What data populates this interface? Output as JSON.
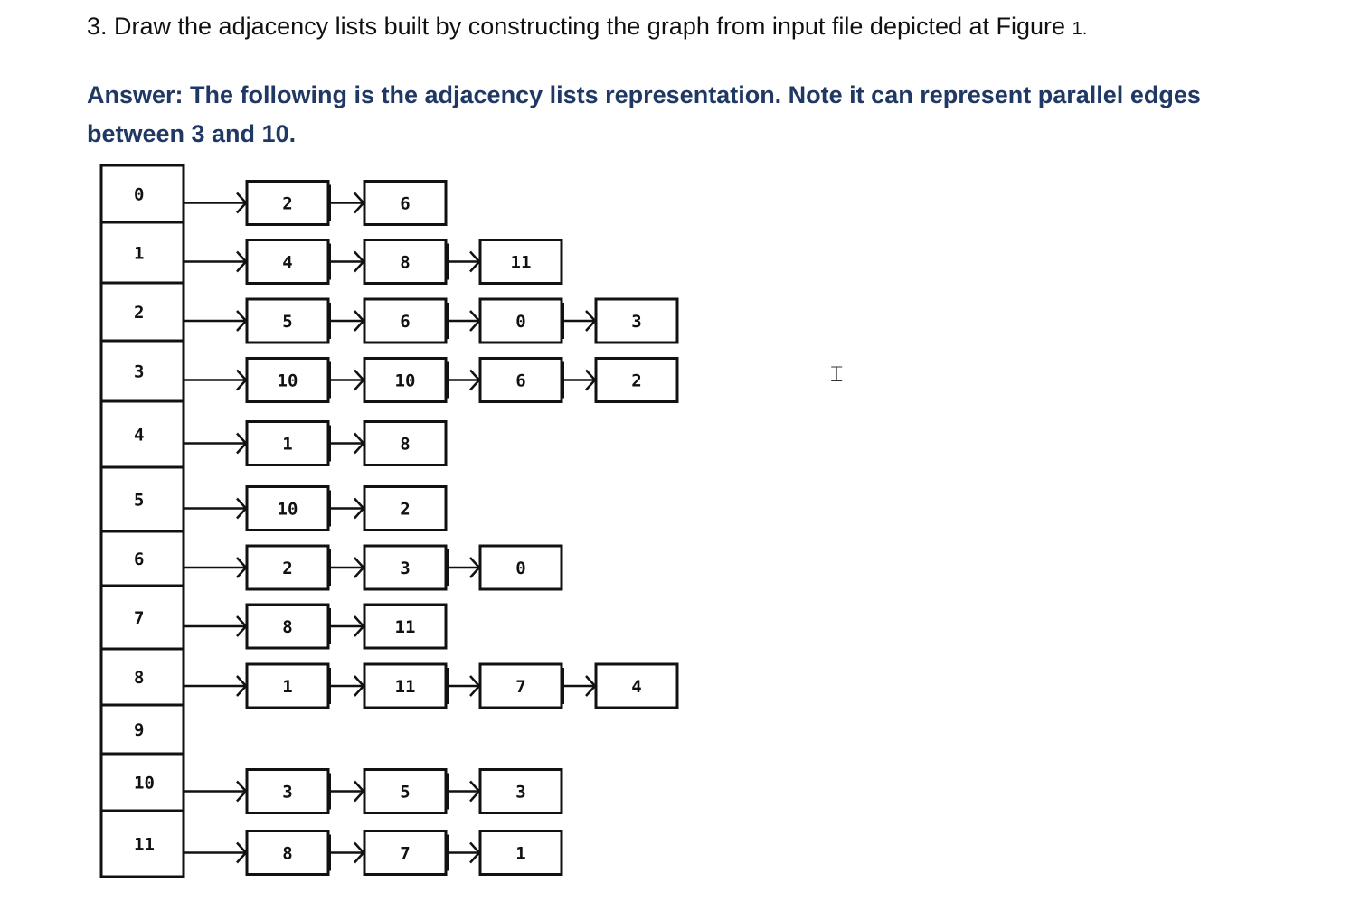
{
  "question": {
    "text": "3. Draw the adjacency lists built by constructing the graph from input file depicted at Figure",
    "figure_ref": "1."
  },
  "answer": {
    "text": "Answer: The following is the adjacency lists representation.  Note it can represent parallel edges between 3 and 10."
  },
  "adjacency_lists": [
    {
      "vertex": "0",
      "neighbors": [
        "2",
        "6"
      ]
    },
    {
      "vertex": "1",
      "neighbors": [
        "4",
        "8",
        "11"
      ]
    },
    {
      "vertex": "2",
      "neighbors": [
        "5",
        "6",
        "0",
        "3"
      ]
    },
    {
      "vertex": "3",
      "neighbors": [
        "10",
        "10",
        "6",
        "2"
      ]
    },
    {
      "vertex": "4",
      "neighbors": [
        "1",
        "8"
      ]
    },
    {
      "vertex": "5",
      "neighbors": [
        "10",
        "2"
      ]
    },
    {
      "vertex": "6",
      "neighbors": [
        "2",
        "3",
        "0"
      ]
    },
    {
      "vertex": "7",
      "neighbors": [
        "8",
        "11"
      ]
    },
    {
      "vertex": "8",
      "neighbors": [
        "1",
        "11",
        "7",
        "4"
      ]
    },
    {
      "vertex": "9",
      "neighbors": []
    },
    {
      "vertex": "10",
      "neighbors": [
        "3",
        "5",
        "3"
      ]
    },
    {
      "vertex": "11",
      "neighbors": [
        "8",
        "7",
        "1"
      ]
    }
  ],
  "cursor_icon": "text-cursor-icon",
  "colors": {
    "answer": "#1f3864",
    "text": "#111111"
  }
}
